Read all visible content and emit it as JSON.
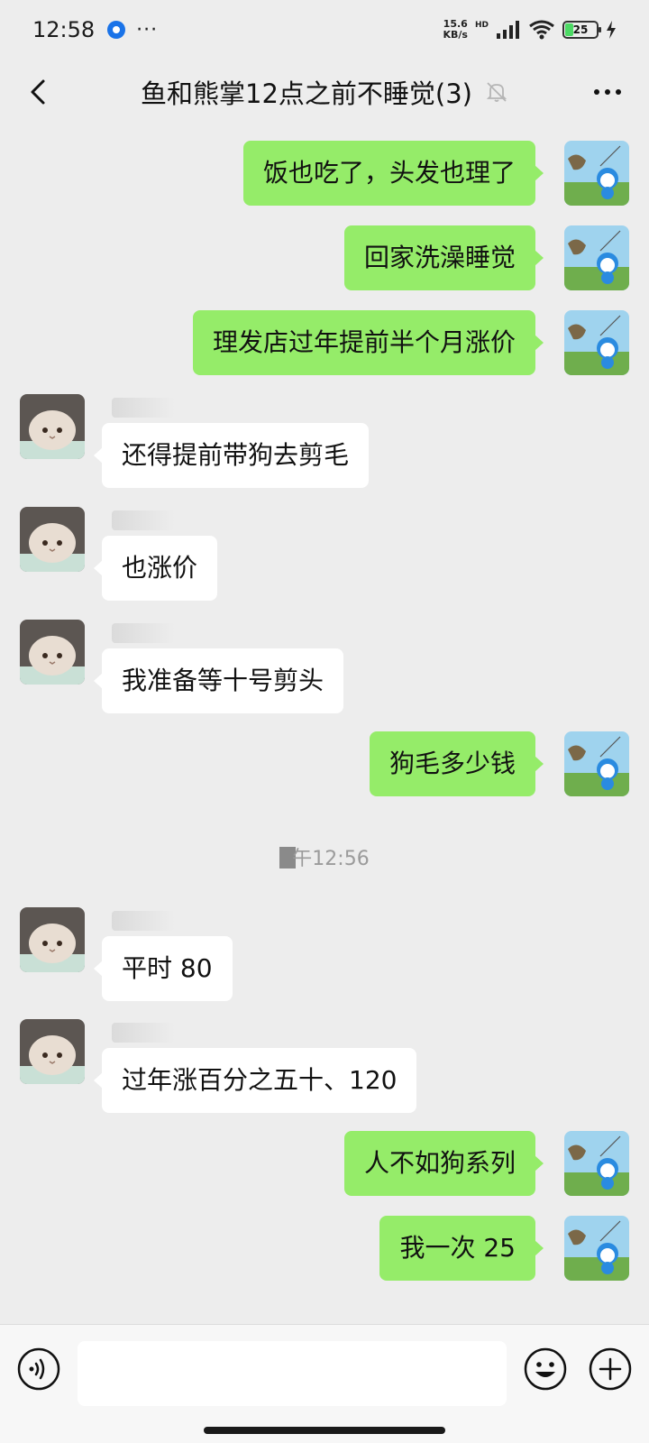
{
  "status_bar": {
    "time": "12:58",
    "dots": "···",
    "net_speed_value": "15.6",
    "net_speed_unit": "KB/s",
    "hd": "HD",
    "battery_level": "25",
    "battery_fraction": 0.25
  },
  "header": {
    "title": "鱼和熊掌12点之前不睡觉(3)"
  },
  "messages": [
    {
      "side": "right",
      "text": "饭也吃了，头发也理了"
    },
    {
      "side": "right",
      "text": "回家洗澡睡觉"
    },
    {
      "side": "right",
      "text": "理发店过年提前半个月涨价"
    },
    {
      "side": "left",
      "text": "还得提前带狗去剪毛"
    },
    {
      "side": "left",
      "text": "也涨价"
    },
    {
      "side": "left",
      "text": "我准备等十号剪头"
    },
    {
      "side": "right",
      "text": "狗毛多少钱"
    },
    {
      "side": "time",
      "text": "午12:56"
    },
    {
      "side": "left",
      "text": "平时 80"
    },
    {
      "side": "left",
      "text": "过年涨百分之五十、120"
    },
    {
      "side": "right",
      "text": "人不如狗系列"
    },
    {
      "side": "right",
      "text": "我一次 25"
    }
  ],
  "input_bar": {
    "placeholder": "",
    "value": ""
  },
  "colors": {
    "outgoing_bubble": "#95ec69",
    "incoming_bubble": "#ffffff",
    "background": "#ededed"
  },
  "icons": {
    "back": "chevron-left-icon",
    "mute": "bell-off-icon",
    "more": "more-dots-icon",
    "voice": "voice-icon",
    "emoji": "emoji-icon",
    "plus": "plus-icon"
  }
}
